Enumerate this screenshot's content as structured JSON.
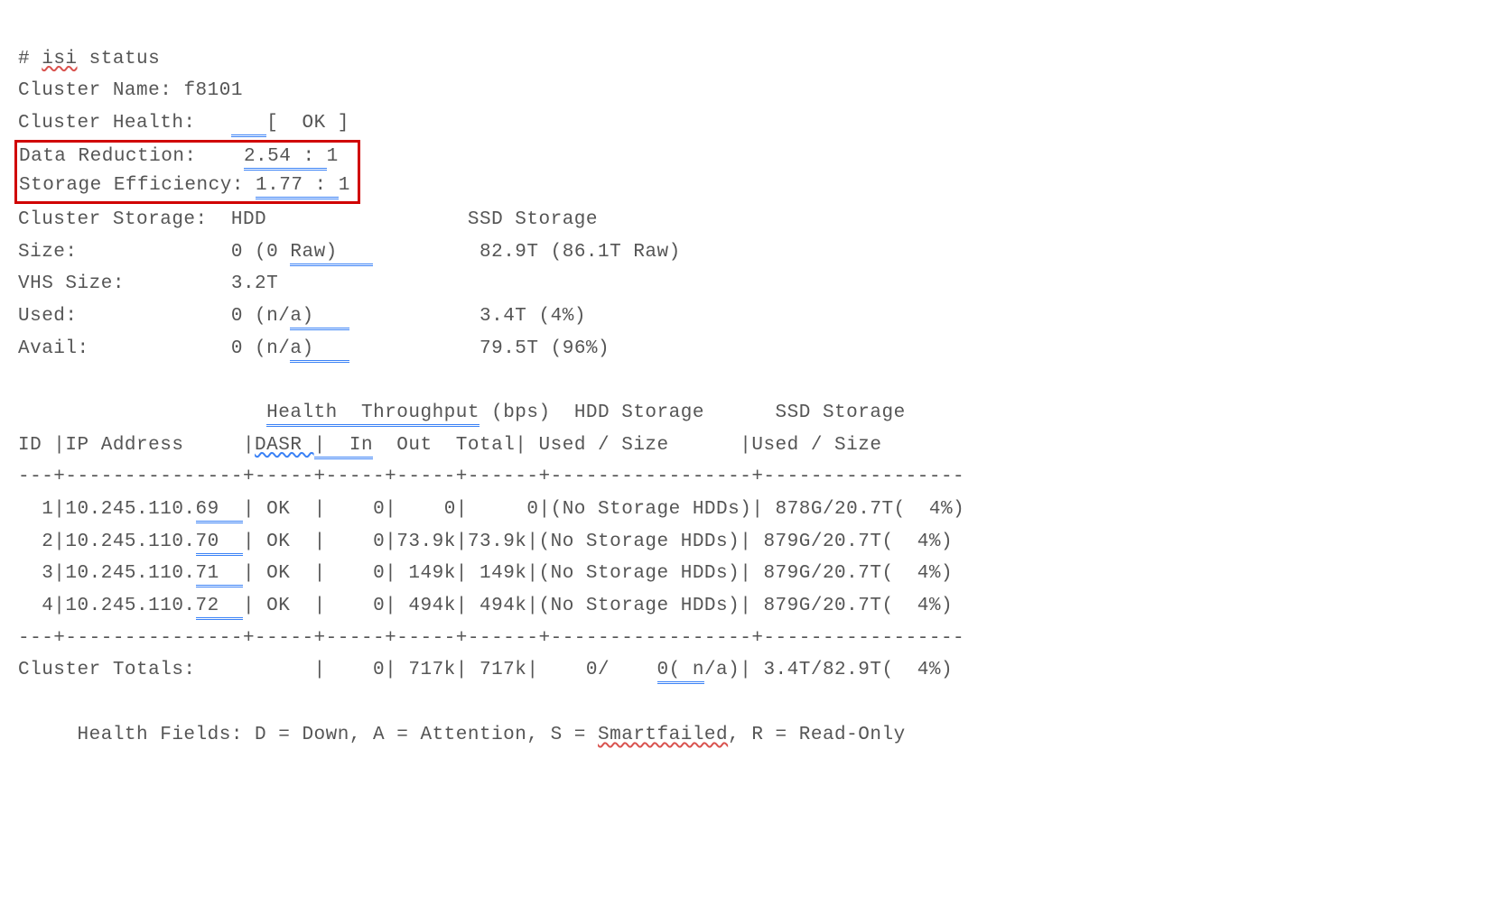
{
  "prompt": "# ",
  "cmd1": "isi",
  "cmd2": " status",
  "clusterNameLabel": "Cluster Name: ",
  "clusterName": "f8101",
  "clusterHealthLabel": "Cluster Health:   ",
  "clusterHealthGap": "   ",
  "clusterHealthVal": "[  OK ]",
  "dataReductionLabel": "Data Reduction:    ",
  "dataReductionVal": "2.54 : ",
  "dataReductionTail": "1",
  "storageEffLabel": "Storage Efficiency: ",
  "storageEffVal": "1.77 : ",
  "storageEffTail": "1",
  "clusterStorageLine": "Cluster Storage:  HDD                 SSD Storage",
  "sizeLabel": "Size:             0 (0 ",
  "sizeRaw1": "Raw)   ",
  "sizeTail": "         82.9T (86.1T Raw)",
  "vhsLine": "VHS Size:         3.2T",
  "usedLabel": "Used:             0 (n/",
  "usedA": "a)   ",
  "usedTail": "           3.4T (4%)",
  "availLabel": "Avail:            0 (n/",
  "availA": "a)   ",
  "availTail": "           79.5T (96%)",
  "tblHdr1a": "                     ",
  "tblHdr1b": "Health  Throughput",
  "tblHdr1c": " (bps)  HDD Storage      SSD Storage",
  "tblHdr2a": "ID |IP Address     |",
  "tblHdr2b": "DASR ",
  "tblHdr2c": "|  In",
  "tblHdr2d": "  Out  Total| Used / Size      |Used / Size",
  "sep": "---+---------------+-----+-----+-----+------+-----------------+-----------------",
  "r1a": "  1|10.245.110.",
  "r1b": "69  ",
  "r1c": "| OK  |    0|    0|     0|(No Storage HDDs)| 878G/20.7T(  4%)",
  "r2a": "  2|10.245.110.",
  "r2b": "70  ",
  "r2c": "| OK  |    0|73.9k|73.9k|(No Storage HDDs)| 879G/20.7T(  4%)",
  "r3a": "  3|10.245.110.",
  "r3b": "71  ",
  "r3c": "| OK  |    0| 149k| 149k|(No Storage HDDs)| 879G/20.7T(  4%)",
  "r4a": "  4|10.245.110.",
  "r4b": "72  ",
  "r4c": "| OK  |    0| 494k| 494k|(No Storage HDDs)| 879G/20.7T(  4%)",
  "totA": "Cluster Totals:          |    0| 717k| 717k|    0/    ",
  "totB": "0( n",
  "totC": "/a)| 3.4T/82.9T(  4%)",
  "legendA": "     Health Fields: D = Down, A = Attention, S = ",
  "legendB": "Smartfailed",
  "legendC": ", R = Read-Only"
}
